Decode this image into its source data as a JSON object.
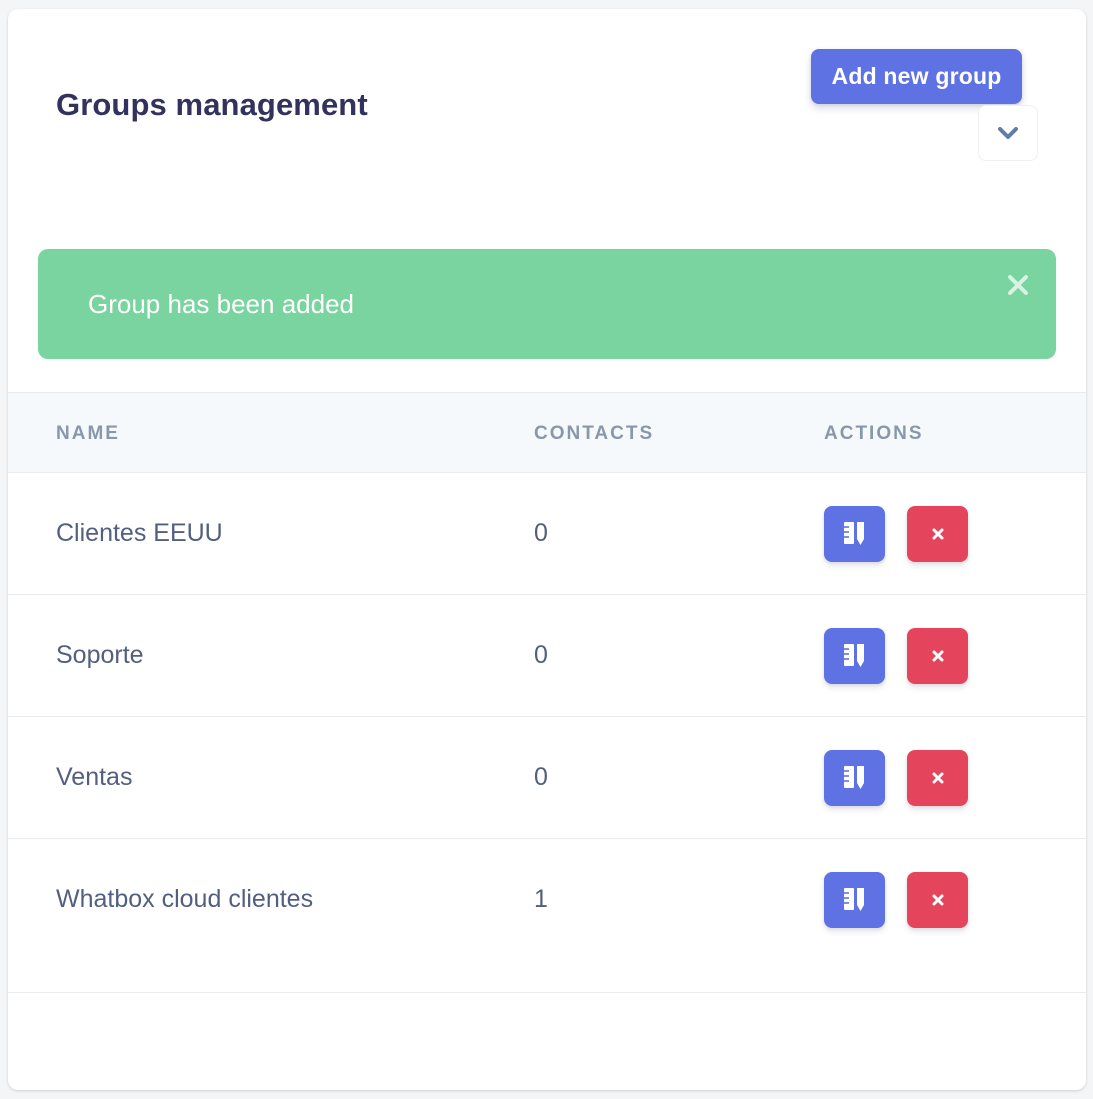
{
  "header": {
    "title": "Groups management",
    "add_button_label": "Add new group",
    "collapse_icon": "chevron-down-icon"
  },
  "alert": {
    "message": "Group has been added",
    "close_icon": "close-icon"
  },
  "table": {
    "columns": [
      "NAME",
      "CONTACTS",
      "ACTIONS"
    ],
    "rows": [
      {
        "name": "Clientes EEUU",
        "contacts": "0"
      },
      {
        "name": "Soporte",
        "contacts": "0"
      },
      {
        "name": "Ventas",
        "contacts": "0"
      },
      {
        "name": "Whatbox cloud clientes",
        "contacts": "1"
      }
    ],
    "edit_icon": "edit-icon",
    "delete_icon": "delete-icon"
  },
  "colors": {
    "primary": "#5e72e4",
    "danger": "#e5455c",
    "success": "#7ad4a0",
    "heading": "#32325d",
    "text": "#525f7f",
    "muted": "#8898aa"
  }
}
